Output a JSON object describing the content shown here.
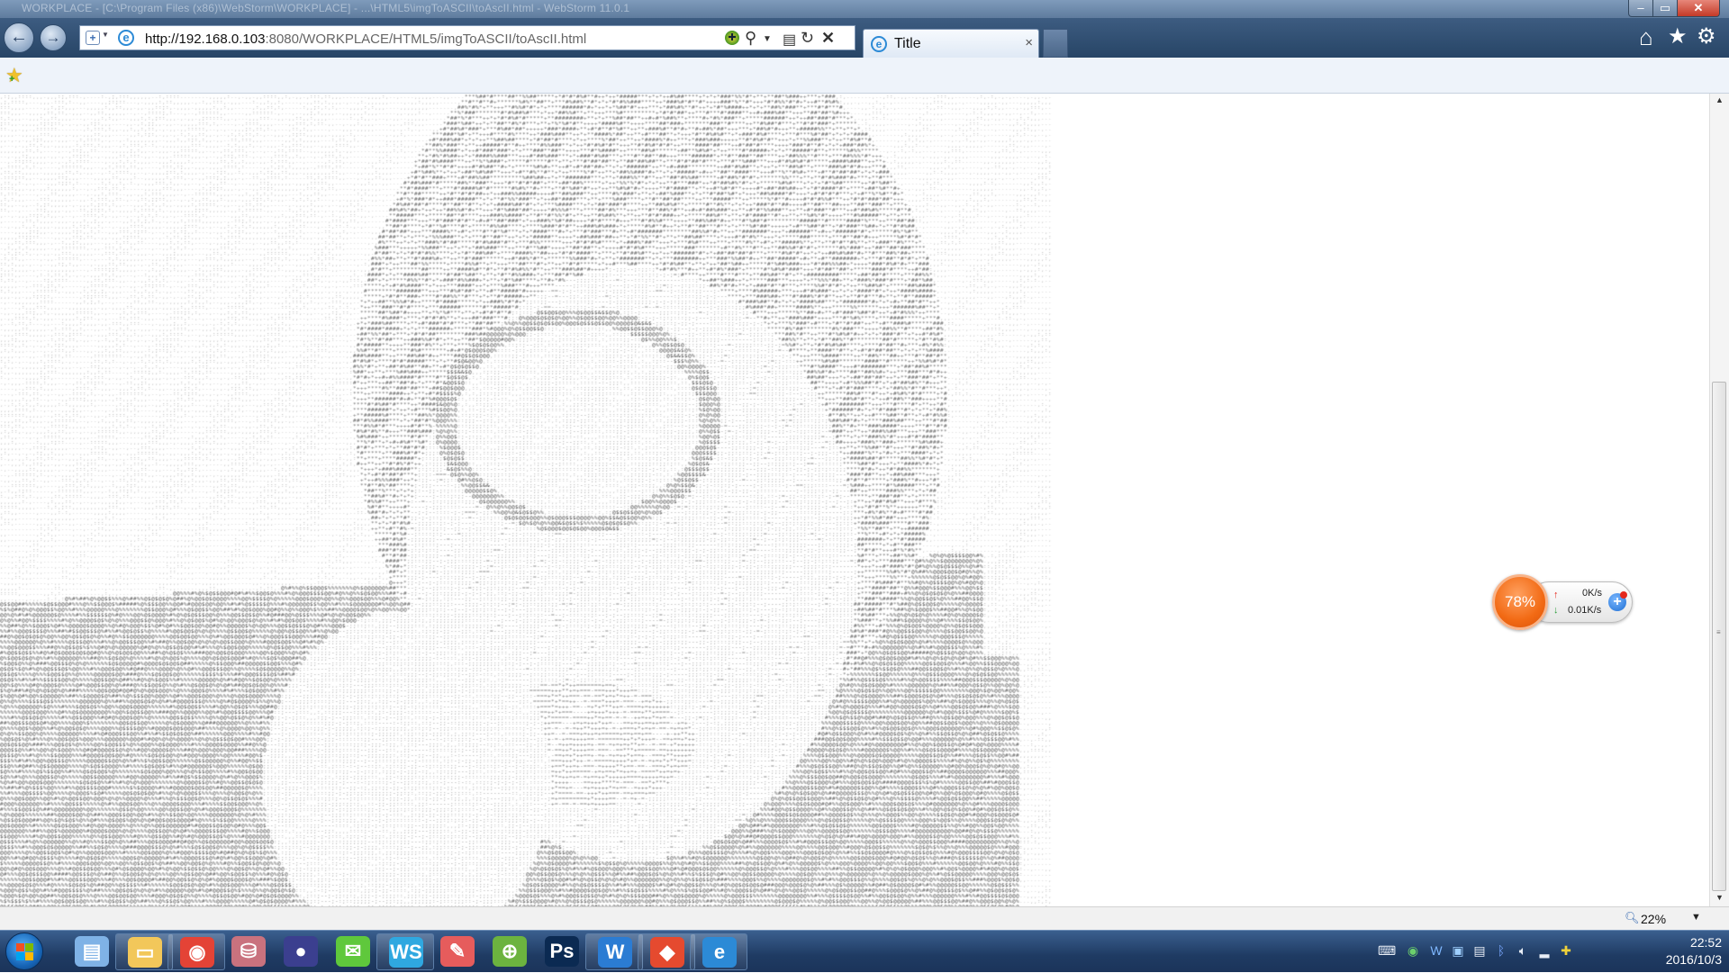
{
  "window": {
    "title_bar_text": "WORKPLACE - [C:\\Program Files (x86)\\WebStorm\\WORKPLACE] - ...\\HTML5\\imgToASCII\\toAscII.html - WebStorm 11.0.1"
  },
  "navigation": {
    "url_host": "http://192.168.0.103",
    "url_path": ":8080/WORKPLACE/HTML5/imgToASCII/toAscII.html",
    "tab_title": "Title",
    "tab_close": "×"
  },
  "content": {
    "description_kind": "ascii-art-render",
    "glyph_set": [
      ".",
      ",",
      ":",
      ";",
      "-",
      "=",
      "+",
      "*",
      "#",
      "%",
      "@",
      "$",
      "&"
    ]
  },
  "net_widget": {
    "percent": "78%",
    "upload": "0K/s",
    "download": "0.01K/s",
    "colors": {
      "ring": "#f26a14",
      "up_arrow": "#e4281c",
      "down_arrow": "#2a9d3a"
    }
  },
  "statusbar": {
    "zoom": "22%"
  },
  "taskbar": {
    "apps": [
      {
        "name": "control-panel-icon",
        "glyph": "▤",
        "color": "#7fb2e6",
        "pinned": false
      },
      {
        "name": "explorer-icon",
        "glyph": "▭",
        "color": "#f2c75a",
        "pinned": true
      },
      {
        "name": "chrome-icon",
        "glyph": "◉",
        "color": "#e44336",
        "pinned": true
      },
      {
        "name": "database-tool-icon",
        "glyph": "⛁",
        "color": "#c9727e",
        "pinned": false
      },
      {
        "name": "eclipse-icon",
        "glyph": "●",
        "color": "#3b3f8f",
        "pinned": false
      },
      {
        "name": "wechat-icon",
        "glyph": "✉",
        "color": "#5fc83c",
        "pinned": false
      },
      {
        "name": "webstorm-icon",
        "glyph": "WS",
        "color": "#2fa8e0",
        "pinned": true
      },
      {
        "name": "paint-icon",
        "glyph": "✎",
        "color": "#e65c5c",
        "pinned": false
      },
      {
        "name": "map-tool-icon",
        "glyph": "⊕",
        "color": "#6cb33f",
        "pinned": false
      },
      {
        "name": "photoshop-icon",
        "glyph": "Ps",
        "color": "#0b2a52",
        "pinned": false
      },
      {
        "name": "word-icon",
        "glyph": "W",
        "color": "#2b7cd3",
        "pinned": true
      },
      {
        "name": "git-icon",
        "glyph": "◆",
        "color": "#e54a2f",
        "pinned": true
      },
      {
        "name": "ie-icon",
        "glyph": "e",
        "color": "#2c8ad6",
        "pinned": true
      }
    ],
    "clock_time": "22:52",
    "clock_date": "2016/10/3"
  }
}
